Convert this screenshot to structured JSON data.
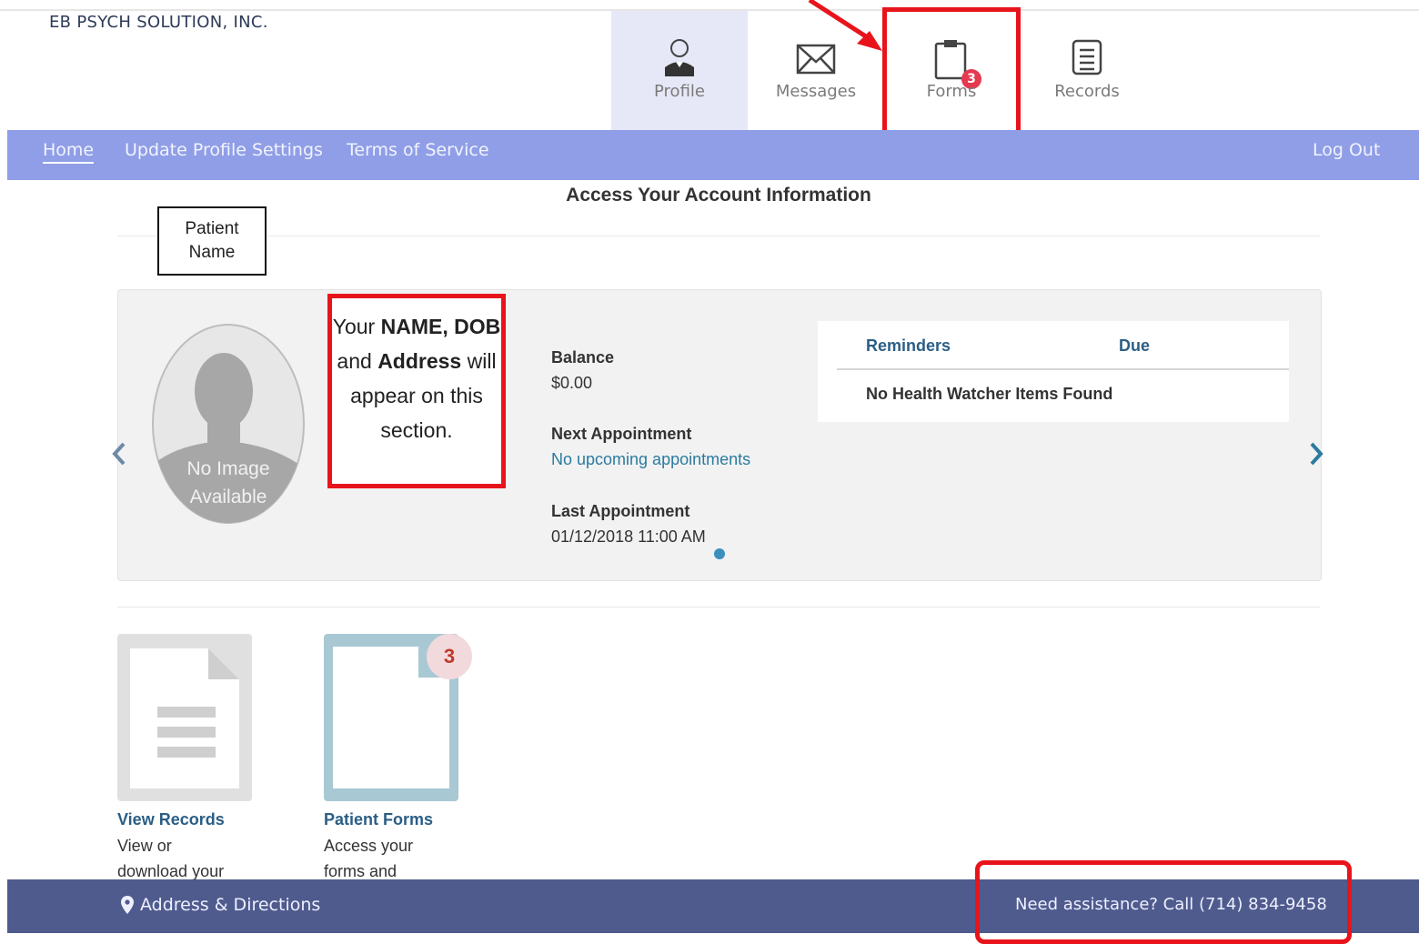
{
  "brand": {
    "name": "EB PSYCH SOLUTION, INC."
  },
  "top_tabs": [
    {
      "label": "Profile",
      "icon": "profile-icon",
      "active": true
    },
    {
      "label": "Messages",
      "icon": "envelope-icon"
    },
    {
      "label": "Forms",
      "icon": "clipboard-icon",
      "badge": "3"
    },
    {
      "label": "Records",
      "icon": "document-list-icon"
    }
  ],
  "nav": {
    "items": [
      "Home",
      "Update Profile Settings",
      "Terms of Service"
    ],
    "logout": "Log Out"
  },
  "page": {
    "title": "Access Your Account Information"
  },
  "callouts": {
    "patient_name": "Patient Name",
    "info_note_parts": [
      "Your ",
      "NAME,",
      " ",
      "DOB",
      " and ",
      "Address",
      " will appear on this section."
    ]
  },
  "account": {
    "photo_placeholder": "No Image Available",
    "balance_label": "Balance",
    "balance_value": "$0.00",
    "next_appt_label": "Next Appointment",
    "next_appt_value": "No upcoming appointments",
    "last_appt_label": "Last Appointment",
    "last_appt_value": "01/12/2018 11:00 AM"
  },
  "reminders": {
    "col1": "Reminders",
    "col2": "Due",
    "empty": "No Health Watcher Items Found"
  },
  "tiles": [
    {
      "title": "View Records",
      "desc_lines": [
        "View or",
        "download your"
      ]
    },
    {
      "title": "Patient Forms",
      "desc_lines": [
        "Access your",
        "forms and"
      ],
      "badge": "3"
    }
  ],
  "footer": {
    "address": "Address & Directions",
    "assist": "Need assistance? Call (714) 834-9458"
  },
  "colors": {
    "nav_bg": "#8f9ee6",
    "footer_bg": "#4f5b8d",
    "callout_red": "#e8141b",
    "link_blue": "#2b7ba0"
  }
}
